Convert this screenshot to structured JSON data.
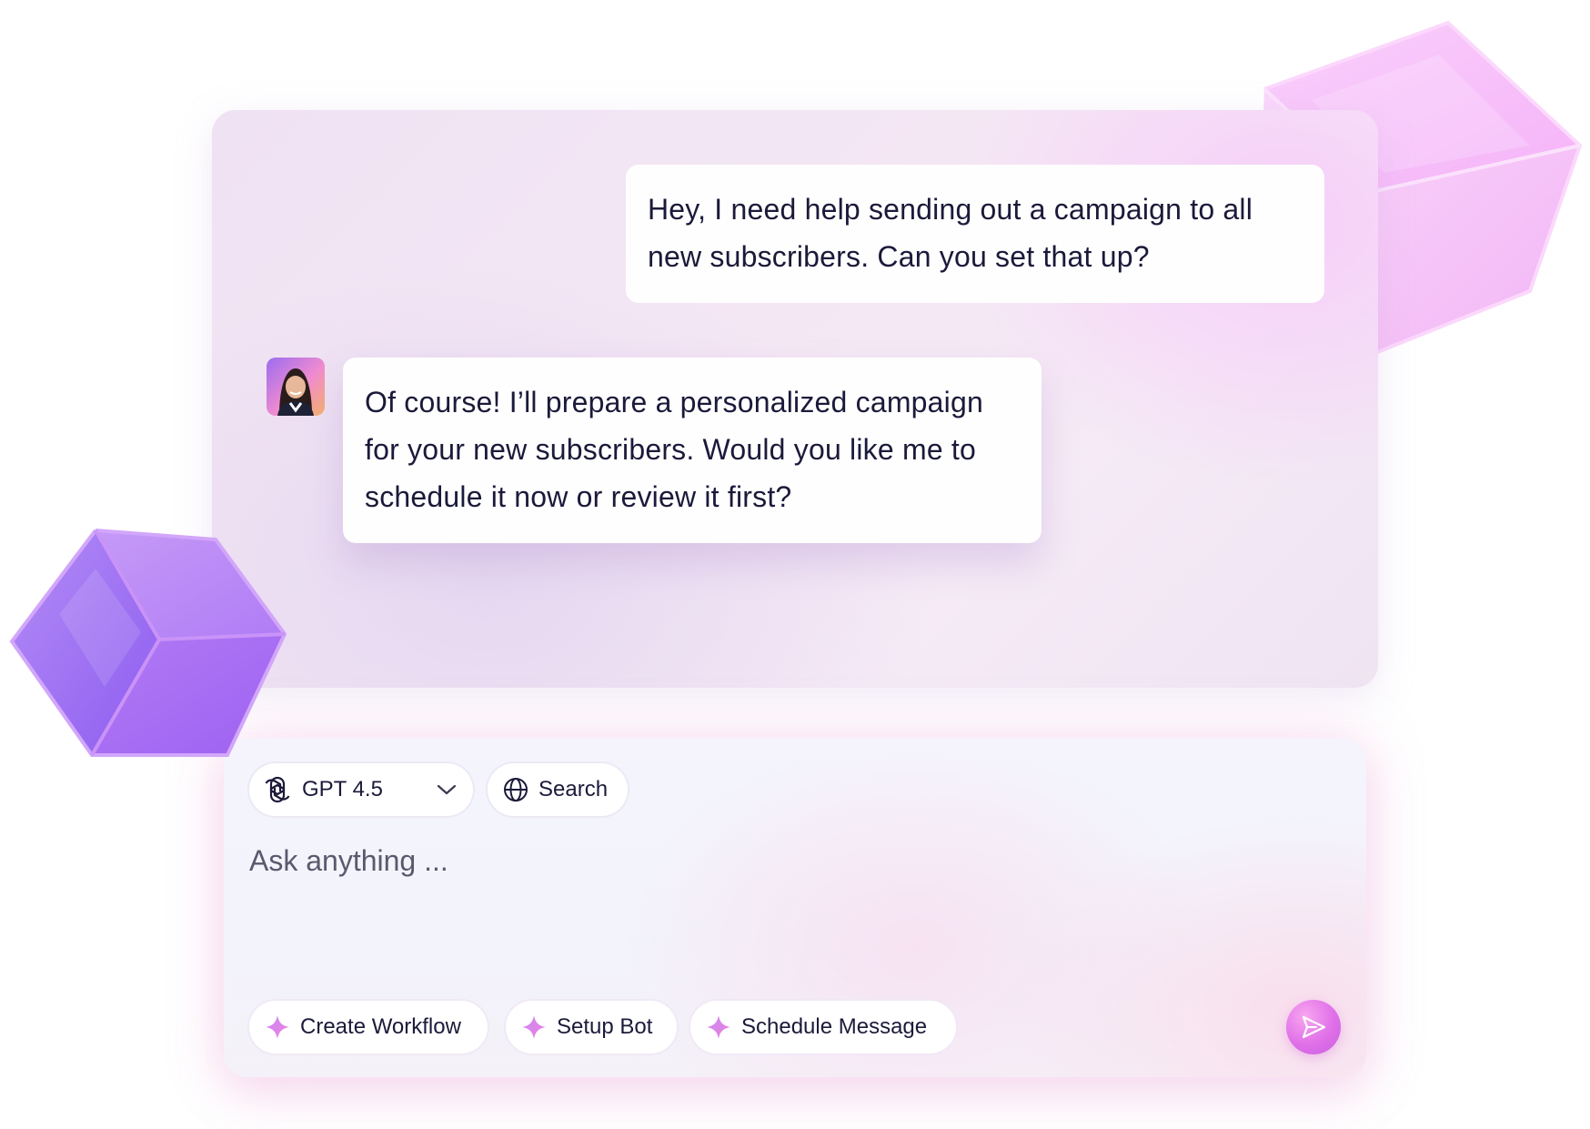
{
  "conversation": {
    "user_message": "Hey, I need help sending out a campaign to all new subscribers. Can you set that up?",
    "assistant_message": "Of course! I’ll prepare a personalized campaign for your new subscribers. Would you like me to schedule it now or review it first?"
  },
  "composer": {
    "model_selector": {
      "icon": "openai-icon",
      "label": "GPT 4.5",
      "dropdown_icon": "chevron-down-icon"
    },
    "search_button": {
      "icon": "globe-icon",
      "label": "Search"
    },
    "input": {
      "placeholder": "Ask anything ...",
      "value": ""
    },
    "quick_actions": [
      {
        "icon": "sparkle-icon",
        "label": "Create Workflow"
      },
      {
        "icon": "sparkle-icon",
        "label": "Setup Bot"
      },
      {
        "icon": "sparkle-icon",
        "label": "Schedule Message"
      }
    ],
    "send_icon": "send-icon"
  },
  "colors": {
    "text": "#1b1a3a",
    "accent_pink": "#e070e8",
    "accent_purple": "#9a5cf2",
    "panel_background": "#f1e5f3"
  }
}
